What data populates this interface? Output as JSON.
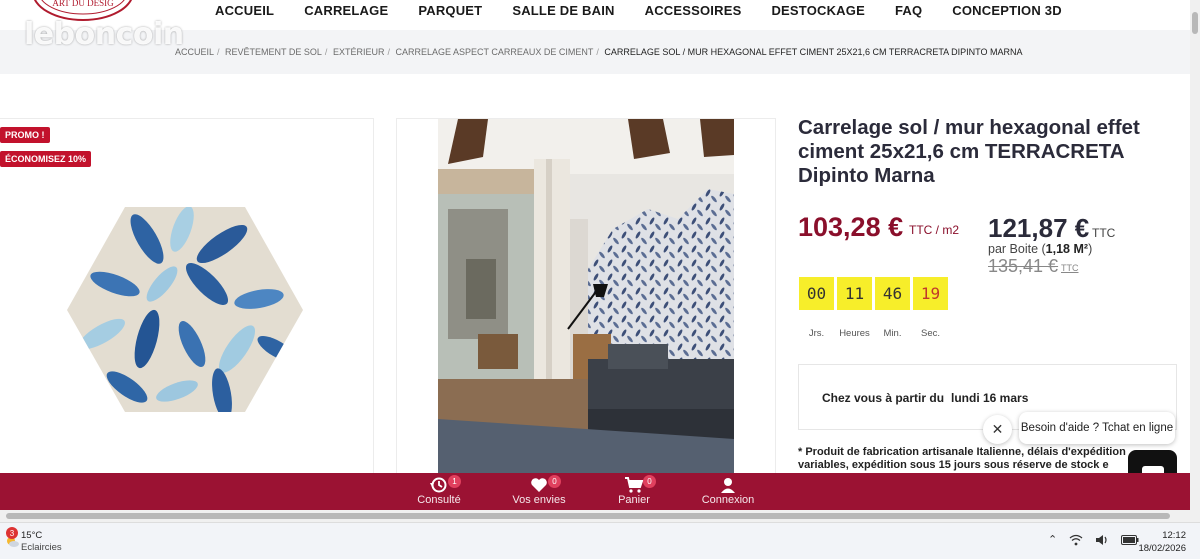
{
  "site": {
    "watermark": "leboncoin",
    "logo_text": "ART DU DESIG"
  },
  "nav": {
    "items": [
      "ACCUEIL",
      "CARRELAGE",
      "PARQUET",
      "SALLE DE BAIN",
      "ACCESSOIRES",
      "DESTOCKAGE",
      "FAQ",
      "CONCEPTION 3D"
    ]
  },
  "breadcrumb": {
    "items": [
      "Accueil",
      "Revêtement de sol",
      "Extérieur",
      "Carrelage aspect carreaux de ciment"
    ],
    "current": "CARRELAGE SOL / MUR HEXAGONAL EFFET CIMENT 25X21,6 CM TERRACRETA DIPINTO MARNA"
  },
  "badges": {
    "promo": "PROMO !",
    "saving": "ÉCONOMISEZ 10%"
  },
  "product": {
    "title": "Carrelage sol / mur hexagonal effet ciment 25x21,6 cm TERRACRETA Dipinto Marna",
    "price_m2": "103,28 €",
    "price_m2_unit": "TTC / m2",
    "price_box": "121,87 €",
    "price_box_ttc": "TTC",
    "per_box_prefix": "par Boite (",
    "per_box_qty": "1,18 M²",
    "per_box_suffix": ")",
    "old_price": "135,41 €",
    "old_price_ttc": "TTC"
  },
  "countdown": {
    "values": [
      "00",
      "11",
      "46",
      "19"
    ],
    "labels": [
      "Jrs.",
      "Heures",
      "Min.",
      "Sec."
    ]
  },
  "delivery": {
    "label": "Chez vous à partir du",
    "date": "lundi 16 mars"
  },
  "footnote": "* Produit de fabrication artisanale Italienne, délais d'expédition variables, expédition sous 15 jours sous réserve de stock e",
  "chat": {
    "bubble": "Besoin d'aide ? Tchat en ligne"
  },
  "bottom_bar": {
    "items": [
      {
        "label": "Consulté",
        "count": "1",
        "icon": "history-icon"
      },
      {
        "label": "Vos envies",
        "count": "0",
        "icon": "heart-icon"
      },
      {
        "label": "Panier",
        "count": "0",
        "icon": "cart-icon"
      },
      {
        "label": "Connexion",
        "count": "",
        "icon": "user-icon"
      }
    ]
  },
  "taskbar": {
    "weather_badge": "3",
    "temperature": "15°C",
    "weather": "Eclaircies",
    "time": "12:12",
    "date": "18/02/2026"
  },
  "colors": {
    "brand": "#9b1233",
    "price": "#8a0f2b",
    "promo": "#c2122c",
    "countdown": "#f7ee2a"
  }
}
